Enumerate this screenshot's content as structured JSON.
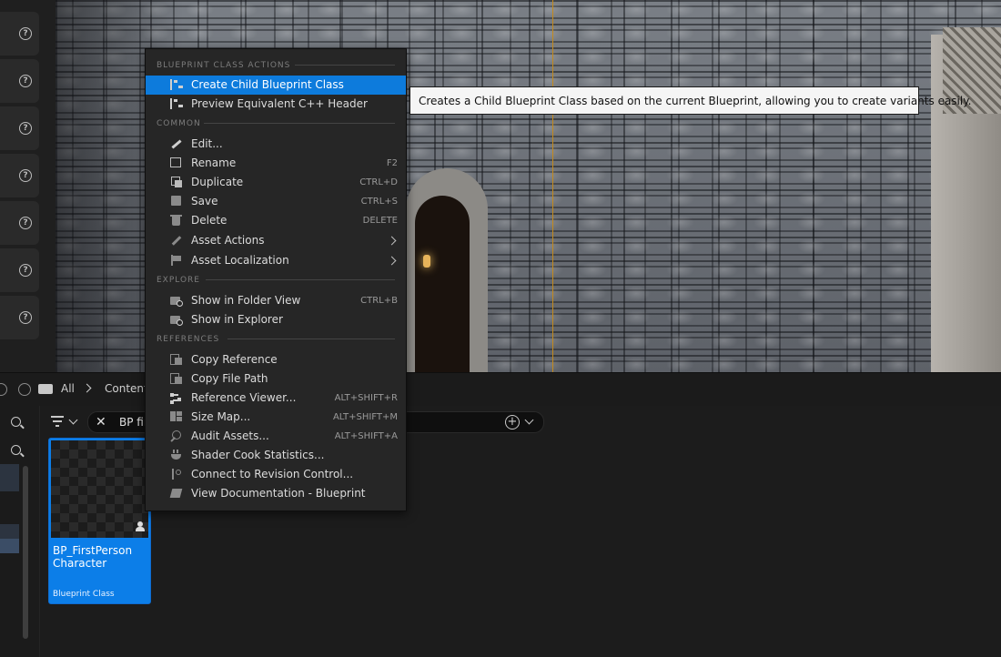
{
  "breadcrumb": {
    "root": "All",
    "current": "Content"
  },
  "search": {
    "value": "BP fir"
  },
  "asset": {
    "name_line1": "BP_FirstPerson",
    "name_line2": "Character",
    "type": "Blueprint Class"
  },
  "context_menu": {
    "sections": {
      "blueprint": "BLUEPRINT CLASS ACTIONS",
      "common": "COMMON",
      "explore": "EXPLORE",
      "references": "REFERENCES"
    },
    "items": [
      {
        "label": "Create Child Blueprint Class",
        "shortcut": "",
        "icon": "child-blueprint-icon",
        "highlighted": true
      },
      {
        "label": "Preview Equivalent C++ Header",
        "shortcut": "",
        "icon": "cpp-header-icon"
      },
      {
        "label": "Edit...",
        "shortcut": "",
        "icon": "pencil-icon"
      },
      {
        "label": "Rename",
        "shortcut": "F2",
        "icon": "rename-icon"
      },
      {
        "label": "Duplicate",
        "shortcut": "CTRL+D",
        "icon": "duplicate-icon"
      },
      {
        "label": "Save",
        "shortcut": "CTRL+S",
        "icon": "save-icon"
      },
      {
        "label": "Delete",
        "shortcut": "DELETE",
        "icon": "trash-icon"
      },
      {
        "label": "Asset Actions",
        "shortcut": "",
        "icon": "wrench-icon",
        "submenu": true
      },
      {
        "label": "Asset Localization",
        "shortcut": "",
        "icon": "flag-icon",
        "submenu": true
      },
      {
        "label": "Show in Folder View",
        "shortcut": "CTRL+B",
        "icon": "folder-search-icon"
      },
      {
        "label": "Show in Explorer",
        "shortcut": "",
        "icon": "folder-search-icon"
      },
      {
        "label": "Copy Reference",
        "shortcut": "",
        "icon": "copy-reference-icon"
      },
      {
        "label": "Copy File Path",
        "shortcut": "",
        "icon": "copy-path-icon"
      },
      {
        "label": "Reference Viewer...",
        "shortcut": "ALT+SHIFT+R",
        "icon": "reference-graph-icon"
      },
      {
        "label": "Size Map...",
        "shortcut": "ALT+SHIFT+M",
        "icon": "size-map-icon"
      },
      {
        "label": "Audit Assets...",
        "shortcut": "ALT+SHIFT+A",
        "icon": "audit-icon"
      },
      {
        "label": "Shader Cook Statistics...",
        "shortcut": "",
        "icon": "shader-pot-icon"
      },
      {
        "label": "Connect to Revision Control...",
        "shortcut": "",
        "icon": "branch-icon"
      },
      {
        "label": "View Documentation - Blueprint",
        "shortcut": "",
        "icon": "documentation-icon"
      }
    ]
  },
  "tooltip": "Creates a Child Blueprint Class based on the current Blueprint, allowing you to create variants easily.",
  "colors": {
    "highlight": "#0d7bdc",
    "asset_selected": "#0c7ee8",
    "guide_line": "#c48a1b"
  }
}
